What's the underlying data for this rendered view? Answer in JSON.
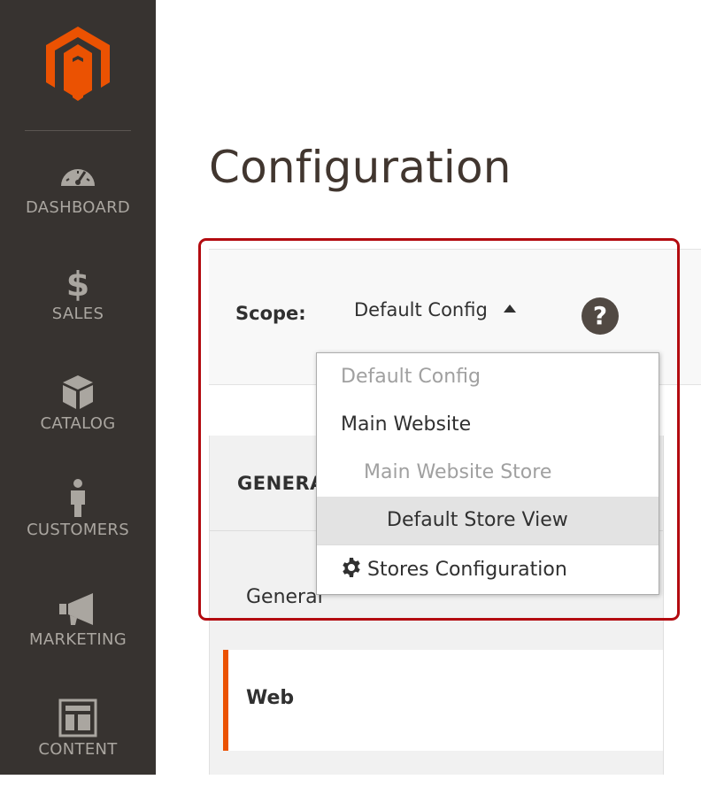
{
  "sidebar": {
    "logo_icon": "magento-logo",
    "items": [
      {
        "label": "DASHBOARD",
        "icon": "speedometer-icon"
      },
      {
        "label": "SALES",
        "icon": "dollar-icon"
      },
      {
        "label": "CATALOG",
        "icon": "box-icon"
      },
      {
        "label": "CUSTOMERS",
        "icon": "person-icon"
      },
      {
        "label": "MARKETING",
        "icon": "megaphone-icon"
      },
      {
        "label": "CONTENT",
        "icon": "layout-icon"
      }
    ]
  },
  "page": {
    "title": "Configuration"
  },
  "scope": {
    "label": "Scope:",
    "current": "Default Config",
    "help_symbol": "?",
    "options": [
      {
        "label": "Default Config",
        "state": "disabled"
      },
      {
        "label": "Main Website",
        "state": "enabled"
      },
      {
        "label": "Main Website Store",
        "state": "disabled"
      },
      {
        "label": "Default Store View",
        "state": "highlighted"
      }
    ],
    "footer_link": "Stores Configuration"
  },
  "tabs": {
    "group_title": "GENERAL",
    "items": [
      {
        "label": "General",
        "active": false
      },
      {
        "label": "Web",
        "active": true
      }
    ]
  },
  "colors": {
    "sidebar_bg": "#373330",
    "accent": "#eb5202",
    "highlight_frame": "#b30b10"
  }
}
